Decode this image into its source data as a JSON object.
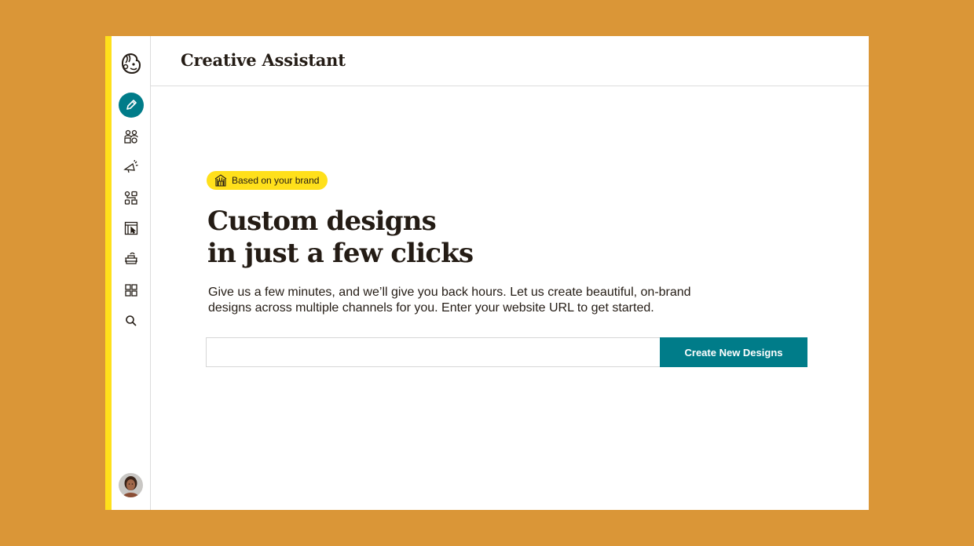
{
  "header": {
    "title": "Creative Assistant"
  },
  "sidebar": {
    "items": [
      {
        "name": "create",
        "icon": "pencil-icon",
        "active": true
      },
      {
        "name": "audience",
        "icon": "audience-icon",
        "active": false
      },
      {
        "name": "campaigns",
        "icon": "megaphone-icon",
        "active": false
      },
      {
        "name": "automations",
        "icon": "automation-icon",
        "active": false
      },
      {
        "name": "website",
        "icon": "website-icon",
        "active": false
      },
      {
        "name": "content-studio",
        "icon": "content-icon",
        "active": false
      },
      {
        "name": "integrations",
        "icon": "grid-icon",
        "active": false
      },
      {
        "name": "search",
        "icon": "search-icon",
        "active": false
      }
    ]
  },
  "main": {
    "badge": {
      "label": "Based on your brand",
      "icon": "storefront-icon"
    },
    "headline": {
      "line1": "Custom designs",
      "line2": "in just a few clicks"
    },
    "description": "Give us a few minutes, and we’ll give you back hours. Let us create beautiful, on-brand designs across multiple channels for you. Enter your website URL to get started.",
    "url_input": {
      "value": "",
      "placeholder": ""
    },
    "create_button_label": "Create New Designs"
  },
  "colors": {
    "background": "#DA9637",
    "accent": "#FFE01B",
    "primary": "#007C89",
    "text": "#241C15"
  }
}
